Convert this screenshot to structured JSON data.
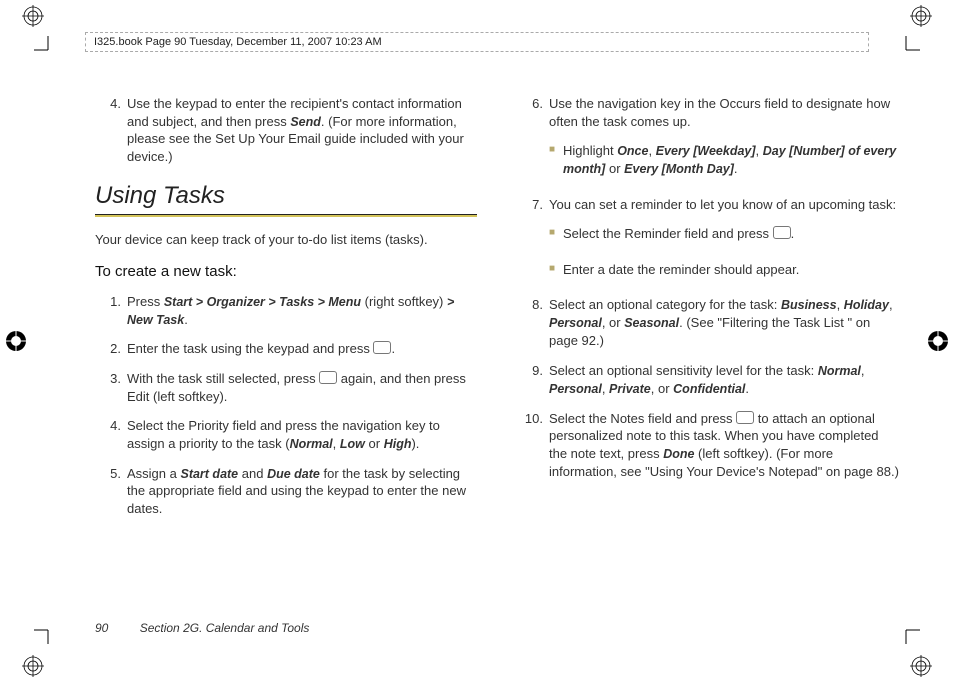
{
  "header": {
    "stamp": "I325.book  Page 90  Tuesday, December 11, 2007  10:23 AM"
  },
  "footer": {
    "page_num": "90",
    "section": "Section 2G. Calendar and Tools"
  },
  "section_title": "Using Tasks",
  "intro": "Your device can keep track of your to-do list items (tasks).",
  "subhead": "To create a new task:",
  "left_prefix_step": {
    "num": "4.",
    "parts": [
      "Use the keypad to enter the recipient's contact information and subject, and then press ",
      "Send",
      ". (For more information, please see the Set Up Your Email guide included with your device.)"
    ]
  },
  "left_steps": [
    {
      "num": "1.",
      "parts": [
        "Press ",
        "Start > Organizer > Tasks > Menu",
        " (right softkey) ",
        "> New Task",
        "."
      ]
    },
    {
      "num": "2.",
      "parts": [
        "Enter the task using the keypad and press ",
        "@KEY",
        "."
      ]
    },
    {
      "num": "3.",
      "parts": [
        "With the task still selected, press ",
        "@KEY",
        " again, and then press Edit (left softkey)."
      ]
    },
    {
      "num": "4.",
      "parts": [
        "Select the Priority field and press the navigation key to assign a priority to the task (",
        "Normal",
        ", ",
        "Low",
        " or ",
        "High",
        ")."
      ]
    },
    {
      "num": "5.",
      "parts": [
        "Assign a ",
        "Start date",
        " and ",
        "Due date",
        " for the task by selecting the appropriate field and using the keypad to enter the new dates."
      ]
    }
  ],
  "right_steps": [
    {
      "num": "6.",
      "parts": [
        "Use the navigation key in the Occurs field to designate how often the task comes up."
      ],
      "subs": [
        {
          "parts": [
            "Highlight ",
            "Once",
            ", ",
            "Every [Weekday]",
            ", ",
            "Day [Number] of every month]",
            " or ",
            "Every [Month Day]",
            "."
          ]
        }
      ]
    },
    {
      "num": "7.",
      "parts": [
        "You can set a reminder to let you know of an upcoming task:"
      ],
      "subs": [
        {
          "parts": [
            "Select the Reminder field and press ",
            "@KEY",
            "."
          ]
        },
        {
          "parts": [
            "Enter a date the reminder should appear."
          ]
        }
      ]
    },
    {
      "num": "8.",
      "parts": [
        "Select an optional category for the task: ",
        "Business",
        ", ",
        "Holiday",
        ", ",
        "Personal",
        ", or ",
        "Seasonal",
        ". (See \"Filtering the Task List \" on page 92.)"
      ]
    },
    {
      "num": "9.",
      "parts": [
        "Select an optional sensitivity level for the task: ",
        "Normal",
        ", ",
        "Personal",
        ", ",
        "Private",
        ", or ",
        "Confidential",
        "."
      ]
    },
    {
      "num": "10.",
      "parts": [
        "Select the Notes field and press ",
        "@KEY",
        " to attach an optional personalized note to this task. When you have completed the note text, press ",
        "Done",
        " (left softkey). (For more information, see \"Using Your Device's Notepad\" on page 88.)"
      ]
    }
  ]
}
